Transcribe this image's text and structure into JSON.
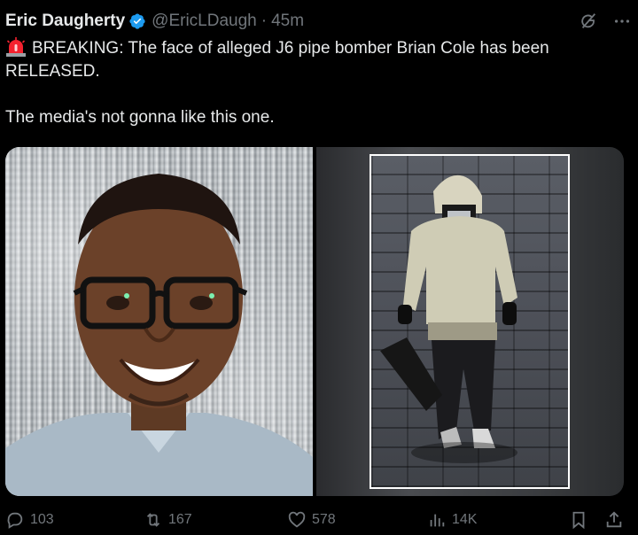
{
  "tweet": {
    "author_name": "Eric Daugherty",
    "handle": "@EricLDaugh",
    "separator": "·",
    "time": "45m",
    "text_line1": "BREAKING: The face of alleged J6 pipe bomber Brian Cole has been RELEASED.",
    "text_line2": "The media's not gonna like this one."
  },
  "metrics": {
    "replies": "103",
    "reposts": "167",
    "likes": "578",
    "views": "14K"
  },
  "colors": {
    "background": "#000000",
    "text": "#e7e9ea",
    "muted": "#71767b",
    "verified": "#1d9bf0",
    "siren": "#f4212e"
  },
  "icons": {
    "verified": "verified-badge-icon",
    "grok": "grok-icon",
    "more": "more-icon",
    "siren": "rotating-light-icon",
    "reply": "reply-icon",
    "repost": "repost-icon",
    "like": "like-icon",
    "views": "views-icon",
    "bookmark": "bookmark-icon",
    "share": "share-icon"
  }
}
